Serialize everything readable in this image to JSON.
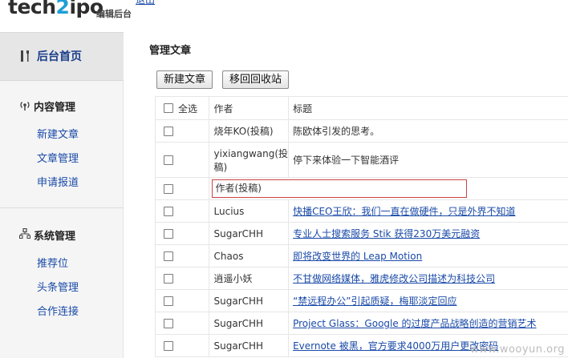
{
  "header": {
    "logo_tech": "tech",
    "logo_two": "2",
    "logo_ipo": "ipo",
    "subtitle": "编辑后台",
    "logout": "退出"
  },
  "sidebar": {
    "home": "后台首页",
    "groups": [
      {
        "title": "内容管理",
        "icon": "signal-icon",
        "items": [
          "新建文章",
          "文章管理",
          "申请报道"
        ]
      },
      {
        "title": "系统管理",
        "icon": "sitemap-icon",
        "items": [
          "推荐位",
          "头条管理",
          "合作连接"
        ]
      }
    ]
  },
  "main": {
    "title": "管理文章",
    "buttons": {
      "new": "新建文章",
      "recycle": "移回回收站"
    },
    "table": {
      "headers": {
        "select_all": "全选",
        "author": "作者",
        "title": "标题"
      },
      "rows": [
        {
          "author": "烧年KO(投稿)",
          "title": "陈欧体引发的思考。",
          "link": false
        },
        {
          "author": "yixiangwang(投稿)",
          "title": "停下来体验一下智能酒评",
          "link": false
        },
        {
          "author": "",
          "title": "",
          "input_value": "作者(投稿)",
          "link": false
        },
        {
          "author": "Lucius",
          "title": "快播CEO王欣：我们一直在做硬件，只是外界不知道",
          "link": true
        },
        {
          "author": "SugarCHH",
          "title": "专业人士搜索服务 Stik 获得230万美元融资",
          "link": true
        },
        {
          "author": "Chaos",
          "title": "即将改变世界的 Leap Motion",
          "link": true
        },
        {
          "author": "逍遥小妖",
          "title": "不甘做网络媒体，雅虎修改公司描述为科技公司",
          "link": true
        },
        {
          "author": "SugarCHH",
          "title": "“禁远程办公”引起质疑，梅耶淡定回应",
          "link": true
        },
        {
          "author": "SugarCHH",
          "title": "Project Glass：Google 的过度产品战略创造的营销艺术",
          "link": true
        },
        {
          "author": "SugarCHH",
          "title": "Evernote 被黑，官方要求4000万用户更改密码",
          "link": true
        }
      ]
    }
  },
  "watermark": "www.wooyun.org"
}
